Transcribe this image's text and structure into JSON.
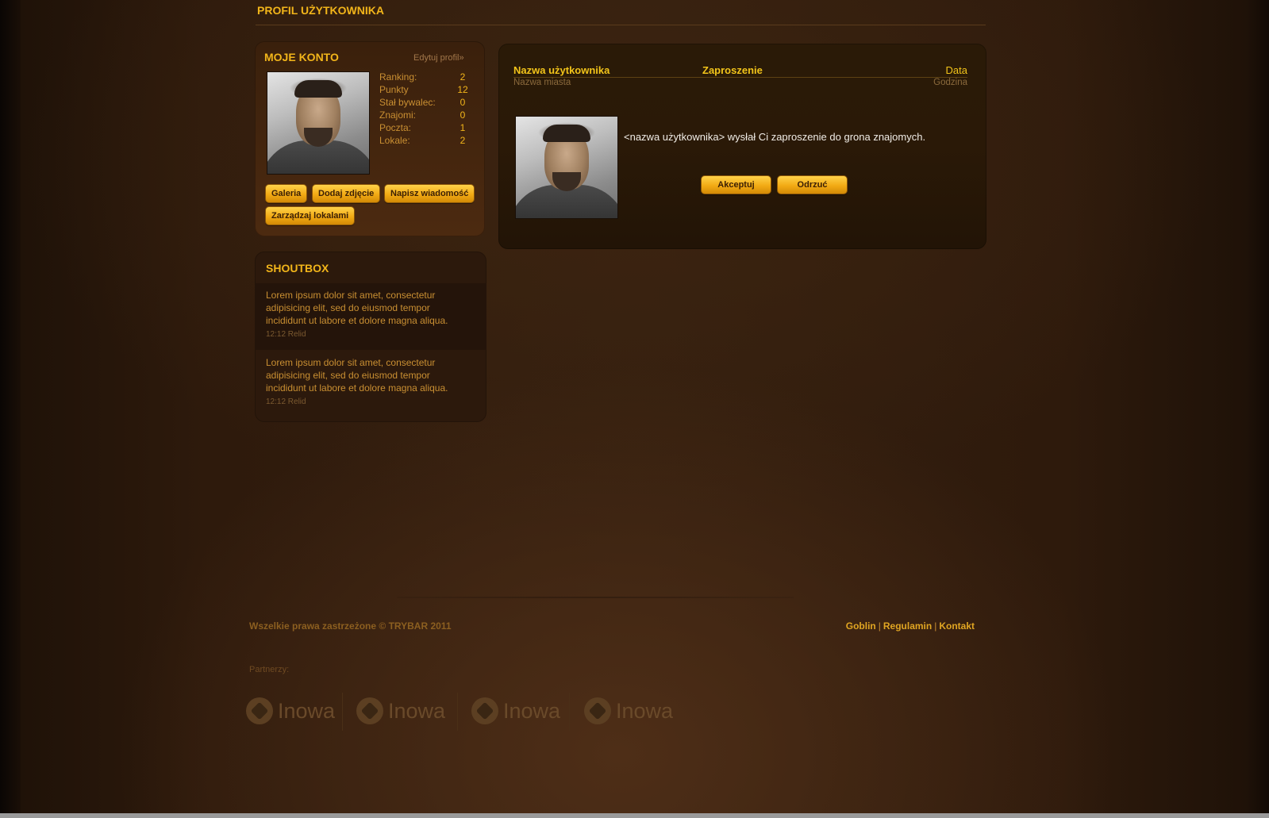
{
  "header": {
    "title": "PROFIL UŻYTKOWNIKA"
  },
  "account": {
    "title": "MOJE KONTO",
    "edit_link": "Edytuj profil»",
    "stats": [
      {
        "label": "Ranking:",
        "value": "2"
      },
      {
        "label": "Punkty",
        "value": "12"
      },
      {
        "label": "Stał bywalec:",
        "value": "0"
      },
      {
        "label": "Znajomi:",
        "value": "0"
      },
      {
        "label": "Poczta:",
        "value": "1"
      },
      {
        "label": "Lokale:",
        "value": "2"
      }
    ],
    "buttons": {
      "gallery": "Galeria",
      "add_photo": "Dodaj zdjęcie",
      "write_message": "Napisz wiadomość",
      "manage_venues": "Zarządzaj lokalami"
    }
  },
  "shoutbox": {
    "title": "SHOUTBOX",
    "items": [
      {
        "text": "Lorem ipsum dolor sit amet, consectetur adipisicing elit, sed do eiusmod tempor incididunt ut labore et dolore magna aliqua.",
        "meta": "12:12 Relid"
      },
      {
        "text": "Lorem ipsum dolor sit amet, consectetur adipisicing elit, sed do eiusmod tempor incididunt ut labore et dolore magna aliqua.",
        "meta": "12:12 Relid"
      }
    ]
  },
  "invitation": {
    "col_user": "Nazwa użytkownika",
    "col_invite": "Zaproszenie",
    "col_date": "Data",
    "sub_city": "Nazwa miasta",
    "sub_time": "Godzina",
    "message": "<nazwa użytkownika> wysłał Ci zaproszenie do grona znajomych.",
    "accept": "Akceptuj",
    "reject": "Odrzuć"
  },
  "footer": {
    "copyright": "Wszelkie prawa zastrzeżone © TRYBAR 2011",
    "links": [
      "Goblin",
      "Regulamin",
      "Kontakt"
    ],
    "separator": "|",
    "partners_label": "Partnerzy:",
    "partners": [
      "Inowa",
      "Inowa",
      "Inowa",
      "Inowa"
    ]
  },
  "colors": {
    "accent": "#f2b51a",
    "button": "#f2aa14",
    "background": "#341f0f"
  }
}
